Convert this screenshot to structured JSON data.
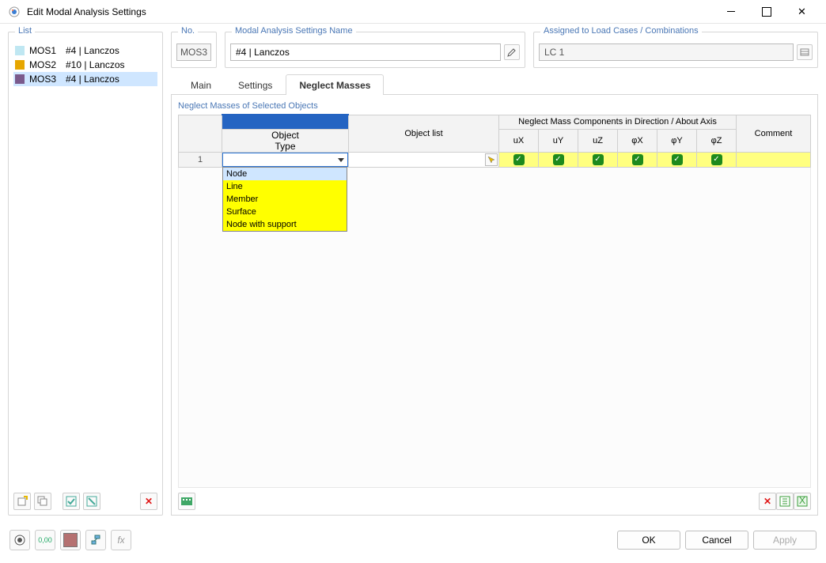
{
  "window": {
    "title": "Edit Modal Analysis Settings"
  },
  "list": {
    "legend": "List",
    "items": [
      {
        "mos": "MOS1",
        "label": "#4 | Lanczos",
        "color": "#bfe7f2"
      },
      {
        "mos": "MOS2",
        "label": "#10 | Lanczos",
        "color": "#e6a600"
      },
      {
        "mos": "MOS3",
        "label": "#4 | Lanczos",
        "color": "#7a5a8c"
      }
    ],
    "selected": 2
  },
  "no": {
    "legend": "No.",
    "value": "MOS3"
  },
  "name": {
    "legend": "Modal Analysis Settings Name",
    "value": "#4 | Lanczos"
  },
  "assigned": {
    "legend": "Assigned to Load Cases / Combinations",
    "value": "LC 1"
  },
  "tabs": {
    "items": [
      "Main",
      "Settings",
      "Neglect Masses"
    ],
    "active": 2
  },
  "grid": {
    "section": "Neglect Masses of Selected Objects",
    "head": {
      "objectTop": "Object",
      "objectType": "Type",
      "objectList": "Object list",
      "neglect": "Neglect Mass Components in Direction / About Axis",
      "cols": [
        "uX",
        "uY",
        "uZ",
        "φX",
        "φY",
        "φZ"
      ],
      "comment": "Comment"
    },
    "row1": {
      "num": "1",
      "checks": [
        true,
        true,
        true,
        true,
        true,
        true
      ]
    },
    "dropdown": {
      "options": [
        "Node",
        "Line",
        "Member",
        "Surface",
        "Node with support"
      ]
    }
  },
  "footer": {
    "ok": "OK",
    "cancel": "Cancel",
    "apply": "Apply"
  }
}
